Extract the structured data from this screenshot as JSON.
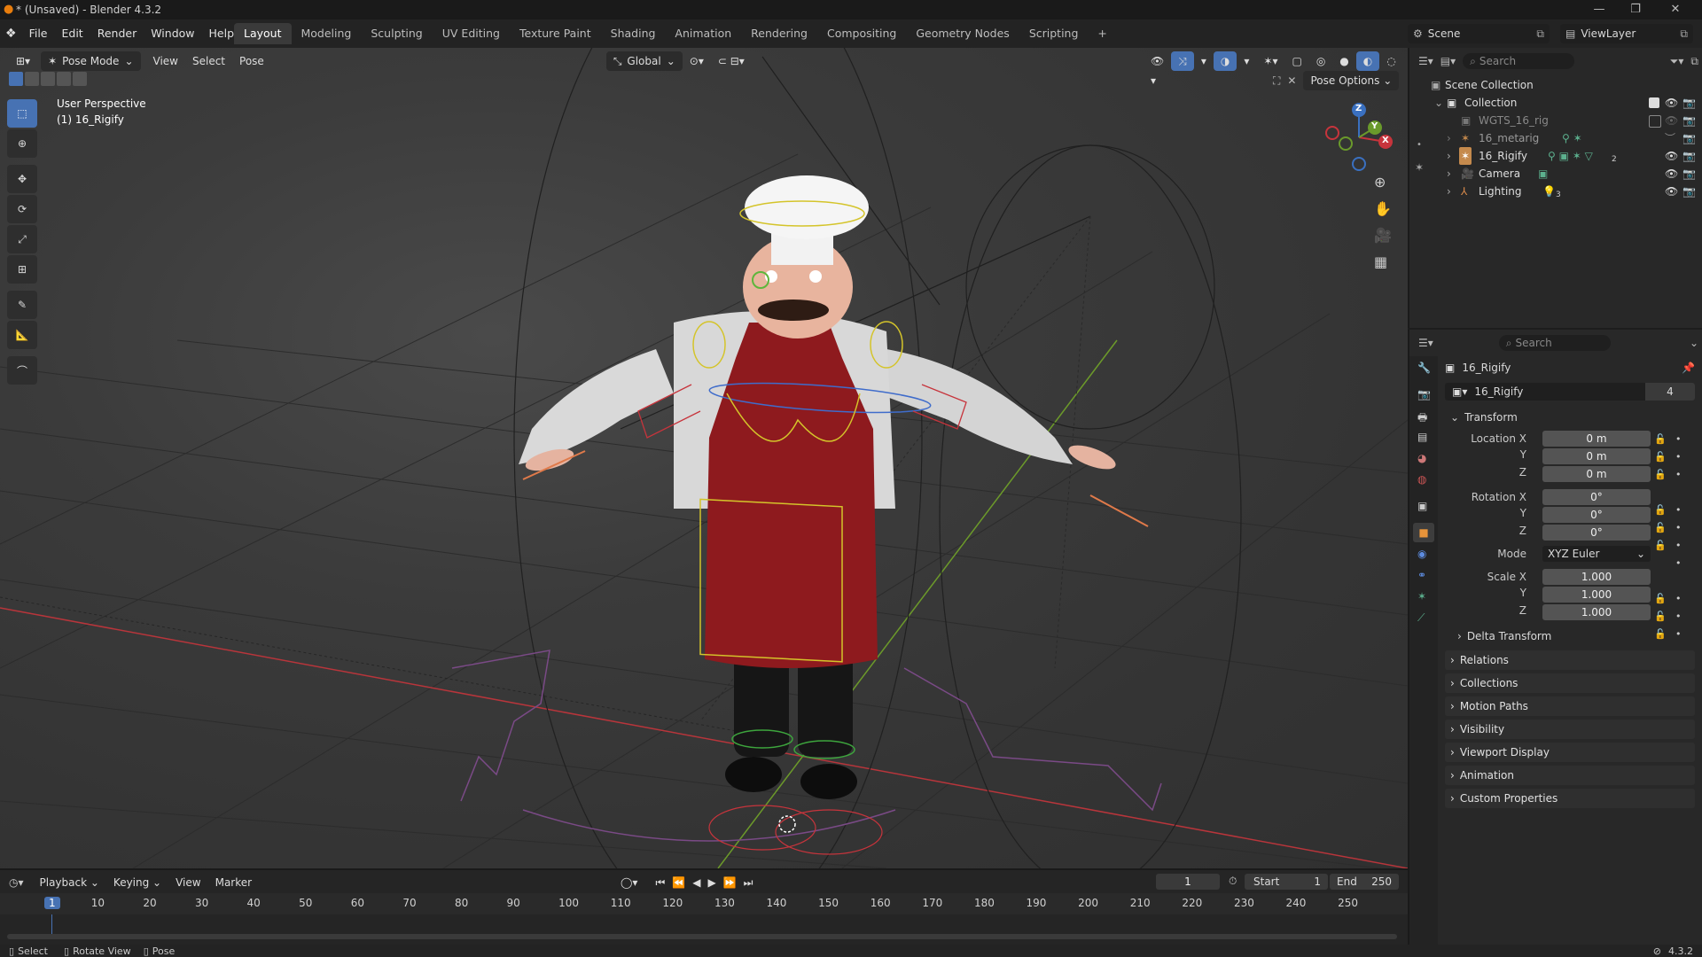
{
  "window": {
    "title": "* (Unsaved) - Blender 4.3.2"
  },
  "menubar": {
    "menus": [
      "File",
      "Edit",
      "Render",
      "Window",
      "Help"
    ],
    "workspaces": [
      "Layout",
      "Modeling",
      "Sculpting",
      "UV Editing",
      "Texture Paint",
      "Shading",
      "Animation",
      "Rendering",
      "Compositing",
      "Geometry Nodes",
      "Scripting"
    ],
    "active_workspace": "Layout",
    "add_tab": "+",
    "scene_name": "Scene",
    "view_layer": "ViewLayer"
  },
  "viewport": {
    "mode": "Pose Mode",
    "menus": [
      "View",
      "Select",
      "Pose"
    ],
    "transform_orientation": "Global",
    "pose_options": "Pose Options",
    "overlay_line1": "User Perspective",
    "overlay_line2": "(1) 16_Rigify",
    "gizmo": {
      "x": "X",
      "y": "Y",
      "z": "Z"
    }
  },
  "outliner": {
    "search_placeholder": "Search",
    "root": "Scene Collection",
    "items": [
      {
        "name": "Collection"
      },
      {
        "name": "WGTS_16_rig"
      },
      {
        "name": "16_metarig"
      },
      {
        "name": "16_Rigify"
      },
      {
        "name": "Camera"
      },
      {
        "name": "Lighting"
      }
    ],
    "badge_2": "2",
    "badge_3": "3"
  },
  "properties": {
    "search_placeholder": "Search",
    "object_name": "16_Rigify",
    "datablock_name": "16_Rigify",
    "users": "4",
    "transform_header": "Transform",
    "location": {
      "label": "Location X",
      "x": "0 m",
      "y": "0 m",
      "z": "0 m"
    },
    "rotation": {
      "label": "Rotation X",
      "x": "0°",
      "y": "0°",
      "z": "0°"
    },
    "mode_label": "Mode",
    "mode_value": "XYZ Euler",
    "scale": {
      "label": "Scale X",
      "x": "1.000",
      "y": "1.000",
      "z": "1.000"
    },
    "axis_y": "Y",
    "axis_z": "Z",
    "delta_transform": "Delta Transform",
    "panels": [
      "Relations",
      "Collections",
      "Motion Paths",
      "Visibility",
      "Viewport Display",
      "Animation",
      "Custom Properties"
    ]
  },
  "timeline": {
    "menus": [
      "Playback",
      "Keying",
      "View",
      "Marker"
    ],
    "current_frame": "1",
    "start_label": "Start",
    "start": "1",
    "end_label": "End",
    "end": "250",
    "ticks": [
      "1",
      "10",
      "20",
      "30",
      "40",
      "50",
      "60",
      "70",
      "80",
      "90",
      "100",
      "110",
      "120",
      "130",
      "140",
      "150",
      "160",
      "170",
      "180",
      "190",
      "200",
      "210",
      "220",
      "230",
      "240",
      "250"
    ]
  },
  "statusbar": {
    "select": "Select",
    "rotate_view": "Rotate View",
    "pose": "Pose",
    "version": "4.3.2"
  },
  "colors": {
    "accent": "#4772b3",
    "selection_yellow": "#d4c42a",
    "axis_red": "#c7343c",
    "axis_green": "#6a9a2b",
    "axis_blue": "#3a70c0",
    "apron": "#8e1a1e"
  }
}
